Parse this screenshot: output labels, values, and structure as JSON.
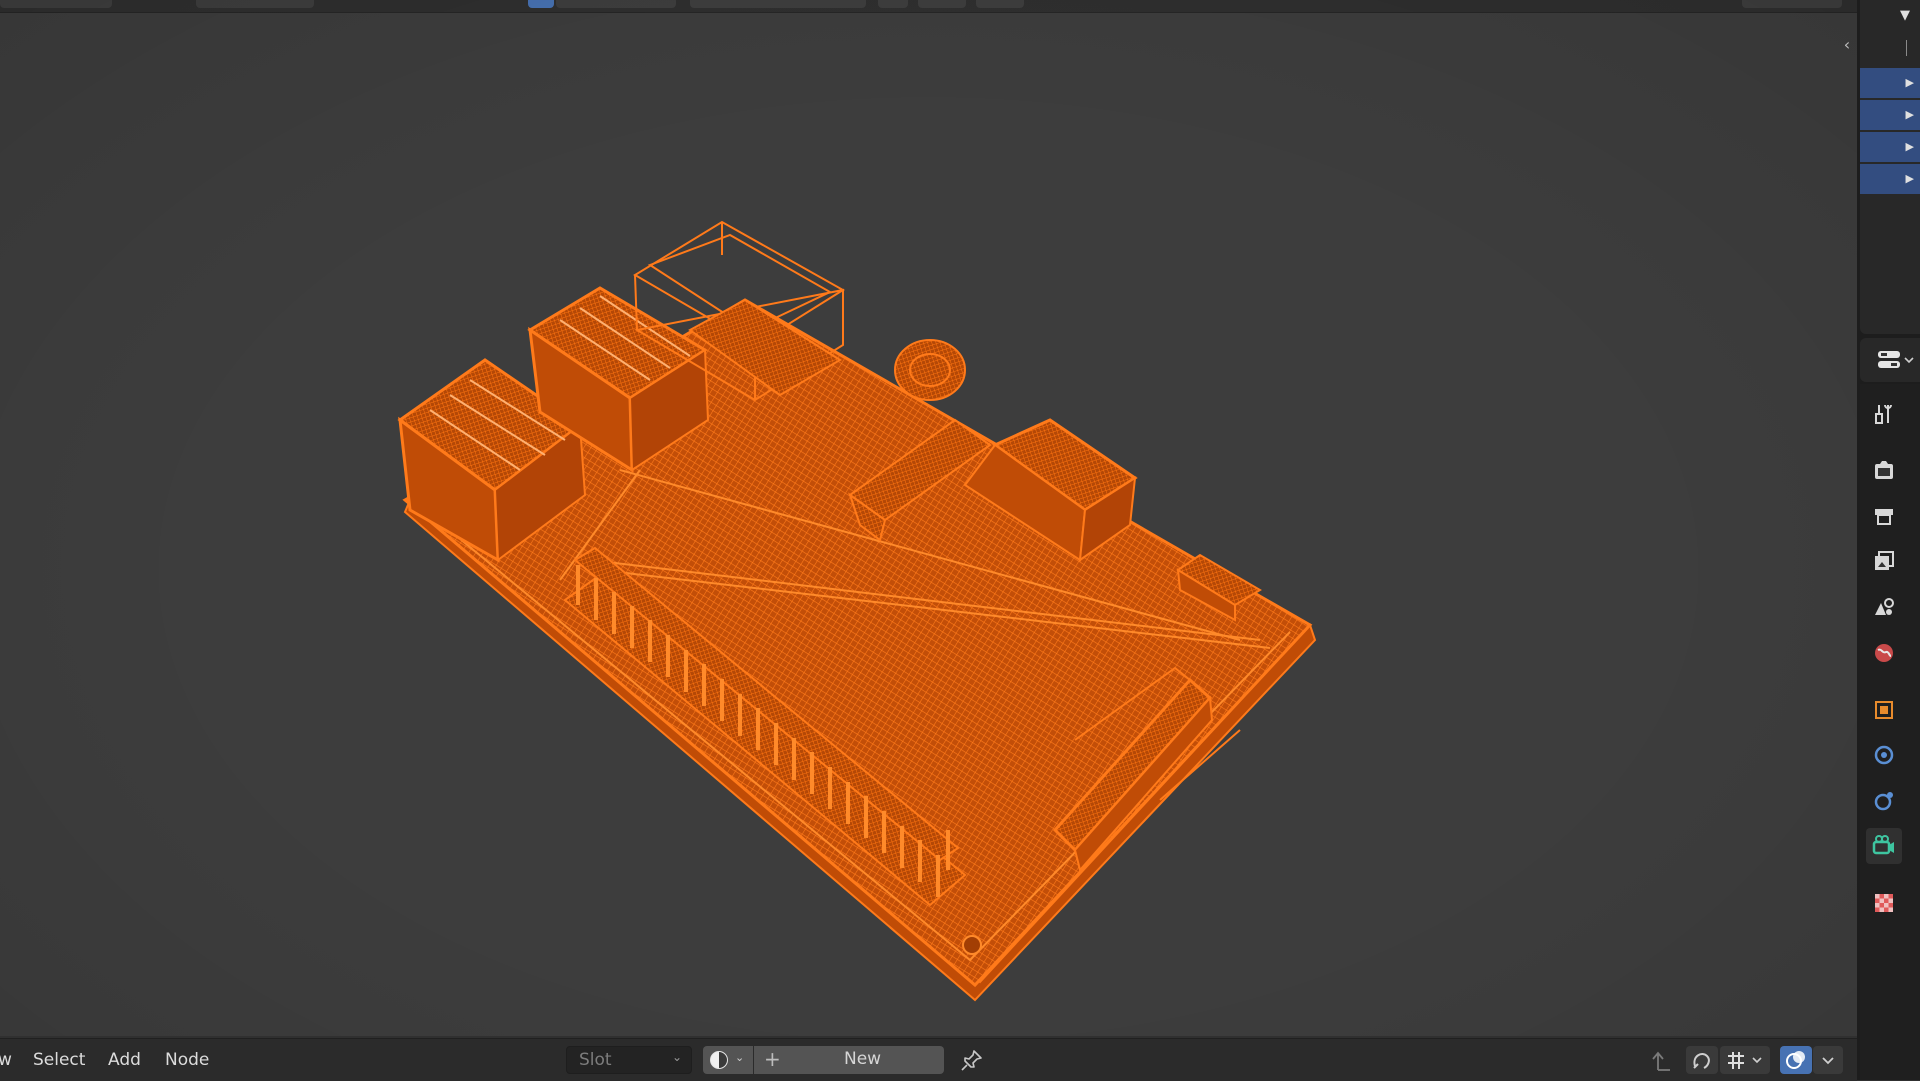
{
  "viewport": {
    "background": "#3d3d3d",
    "wire_color": "#ff6a00",
    "collapse_icon": "chevron-left-icon"
  },
  "node_header": {
    "menu": [
      "w",
      "Select",
      "Add",
      "Node"
    ],
    "slot": {
      "label": "Slot",
      "icon": "chevron-down-icon"
    },
    "material_preview_icon": "material-sphere-icon",
    "new_button": {
      "label": "New",
      "icon": "plus-icon"
    },
    "pin_icon": "pin-icon",
    "right_icons": [
      "parent-arrow-icon",
      "snap-magnet-icon",
      "snap-grid-icon",
      "overlay-icon",
      "chevron-down-icon"
    ]
  },
  "outliner": {
    "filter_icon": "filter-down-icon",
    "rows": [
      {
        "expander": "▶",
        "selected": true
      },
      {
        "expander": "▶",
        "selected": true
      },
      {
        "expander": "▶",
        "selected": true
      },
      {
        "expander": "▶",
        "selected": true
      }
    ]
  },
  "properties_tabs": [
    {
      "name": "tool-tab-icon"
    },
    {
      "name": "render-tab-icon"
    },
    {
      "name": "output-tab-icon"
    },
    {
      "name": "view-layer-tab-icon"
    },
    {
      "name": "scene-tab-icon"
    },
    {
      "name": "world-tab-icon"
    },
    {
      "name": "object-tab-icon"
    },
    {
      "name": "modifier-tab-icon"
    },
    {
      "name": "physics-tab-icon"
    },
    {
      "name": "object-data-tab-icon",
      "active": true
    },
    {
      "name": "texture-tab-icon"
    }
  ]
}
